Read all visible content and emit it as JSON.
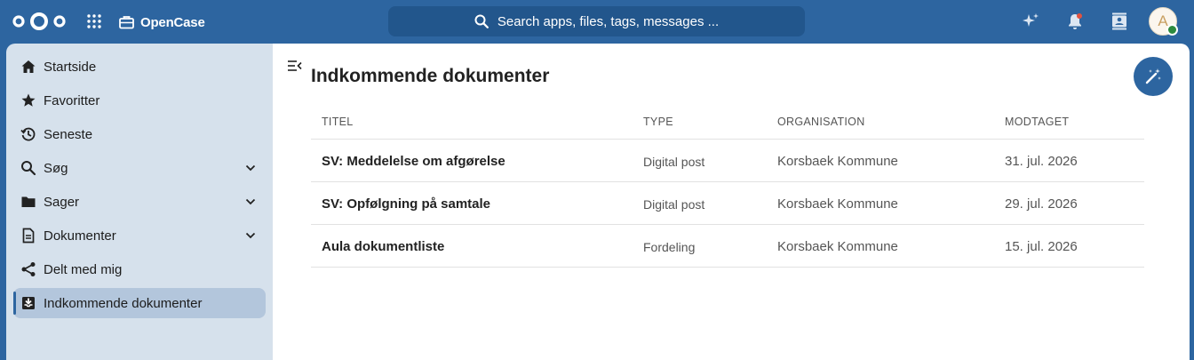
{
  "header": {
    "app_name": "OpenCase",
    "search_placeholder": "Search apps, files, tags, messages ...",
    "avatar_initial": "A",
    "icons": [
      "nextcloud-logo",
      "apps-grid-icon",
      "briefcase-icon",
      "search-icon",
      "assistant-sparkle-icon",
      "notifications-bell-icon",
      "contacts-icon",
      "avatar"
    ]
  },
  "sidebar": {
    "items": [
      {
        "label": "Startside",
        "icon": "home-icon",
        "expandable": false,
        "active": false
      },
      {
        "label": "Favoritter",
        "icon": "star-icon",
        "expandable": false,
        "active": false
      },
      {
        "label": "Seneste",
        "icon": "history-icon",
        "expandable": false,
        "active": false
      },
      {
        "label": "Søg",
        "icon": "magnify-icon",
        "expandable": true,
        "active": false
      },
      {
        "label": "Sager",
        "icon": "folder-icon",
        "expandable": true,
        "active": false
      },
      {
        "label": "Dokumenter",
        "icon": "document-icon",
        "expandable": true,
        "active": false
      },
      {
        "label": "Delt med mig",
        "icon": "share-icon",
        "expandable": false,
        "active": false
      },
      {
        "label": "Indkommende dokumenter",
        "icon": "inbox-download-icon",
        "expandable": false,
        "active": true
      }
    ]
  },
  "main": {
    "title": "Indkommende dokumenter",
    "columns": [
      "TITEL",
      "TYPE",
      "ORGANISATION",
      "MODTAGET"
    ],
    "rows": [
      {
        "title": "SV: Meddelelse om afgørelse",
        "type": "Digital post",
        "organisation": "Korsbaek Kommune",
        "received": "31. jul. 2026"
      },
      {
        "title": "SV: Opfølgning på samtale",
        "type": "Digital post",
        "organisation": "Korsbaek Kommune",
        "received": "29. jul. 2026"
      },
      {
        "title": "Aula dokumentliste",
        "type": "Fordeling",
        "organisation": "Korsbaek Kommune",
        "received": "15. jul. 2026"
      }
    ]
  },
  "colors": {
    "header_bg": "#2d65a0",
    "sidebar_bg": "#d6e1ec",
    "active_item_bg": "#b3c6dc",
    "accent": "#2d65a0"
  }
}
